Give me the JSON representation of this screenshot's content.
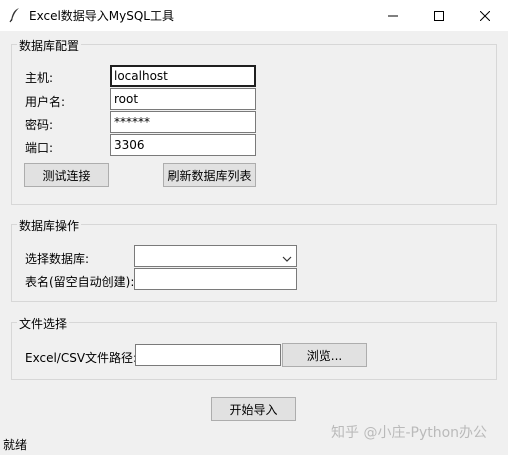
{
  "window": {
    "title": "Excel数据导入MySQL工具",
    "controls": [
      "minimize-icon",
      "maximize-icon",
      "close-icon"
    ]
  },
  "db_config": {
    "title": "数据库配置",
    "host_label": "主机:",
    "host_value": "localhost",
    "user_label": "用户名:",
    "user_value": "root",
    "password_label": "密码:",
    "password_value": "******",
    "port_label": "端口:",
    "port_value": "3306",
    "test_button": "测试连接",
    "refresh_button": "刷新数据库列表"
  },
  "db_ops": {
    "title": "数据库操作",
    "select_db_label": "选择数据库:",
    "select_db_value": "",
    "table_name_label": "表名(留空自动创建):",
    "table_name_value": ""
  },
  "file_select": {
    "title": "文件选择",
    "path_label": "Excel/CSV文件路径:",
    "path_value": "",
    "browse_button": "浏览..."
  },
  "actions": {
    "start_button": "开始导入"
  },
  "status": {
    "text": "就绪"
  },
  "watermark": {
    "text": "知乎 @小庄-Python办公"
  },
  "colors": {
    "window_bg": "#f0f0f0",
    "titlebar_bg": "#ffffff",
    "button_bg": "#e1e1e1",
    "border": "#d7d7d7"
  }
}
